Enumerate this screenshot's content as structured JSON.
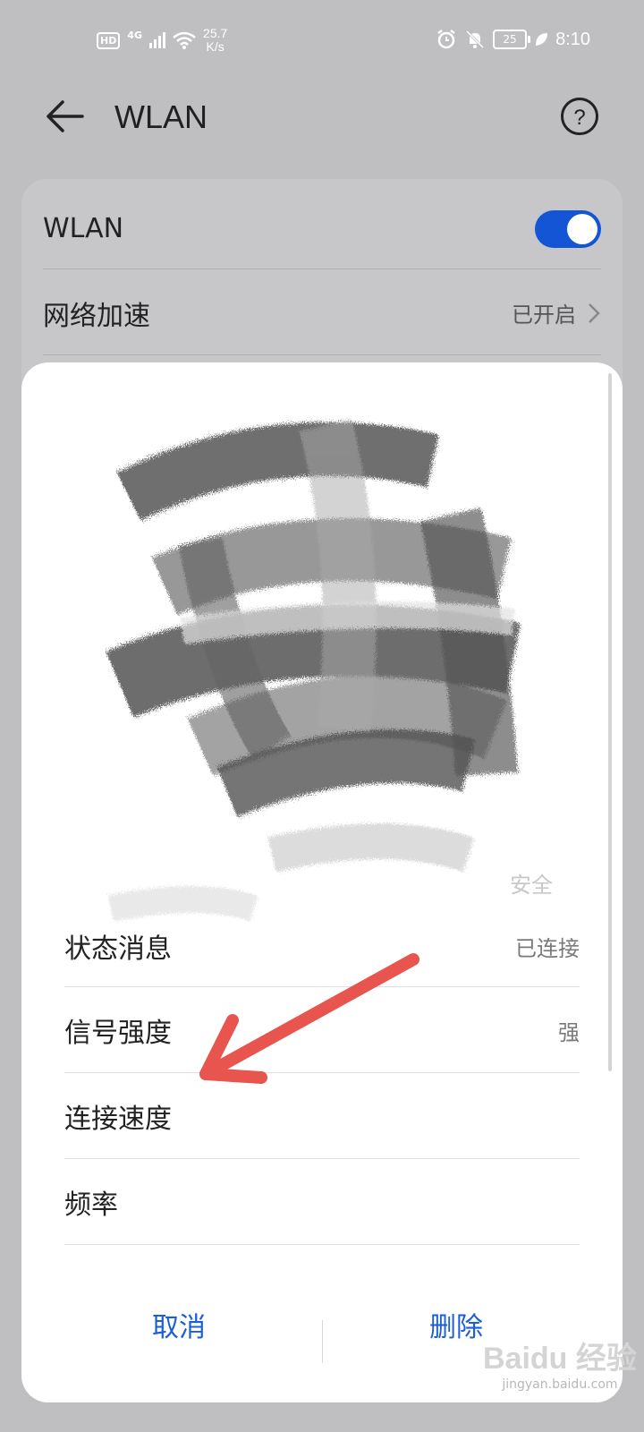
{
  "status_bar": {
    "hd": "HD",
    "network": "4G",
    "speed_value": "25.7",
    "speed_unit": "K/s",
    "battery": "25",
    "time": "8:10"
  },
  "header": {
    "title": "WLAN"
  },
  "settings": {
    "wlan_label": "WLAN",
    "wlan_enabled": true,
    "acceleration_label": "网络加速",
    "acceleration_value": "已开启"
  },
  "dialog": {
    "security_text": "安全",
    "rows": [
      {
        "label": "状态消息",
        "value": "已连接"
      },
      {
        "label": "信号强度",
        "value": "强"
      },
      {
        "label": "连接速度",
        "value": ""
      },
      {
        "label": "频率",
        "value": ""
      }
    ],
    "cancel_label": "取消",
    "delete_label": "删除"
  },
  "watermark": {
    "logo": "Baidu 经验",
    "url": "jingyan.baidu.com"
  },
  "colors": {
    "accent": "#1355d4",
    "annotation_arrow": "#e8554e",
    "background": "#bfbfc2"
  }
}
